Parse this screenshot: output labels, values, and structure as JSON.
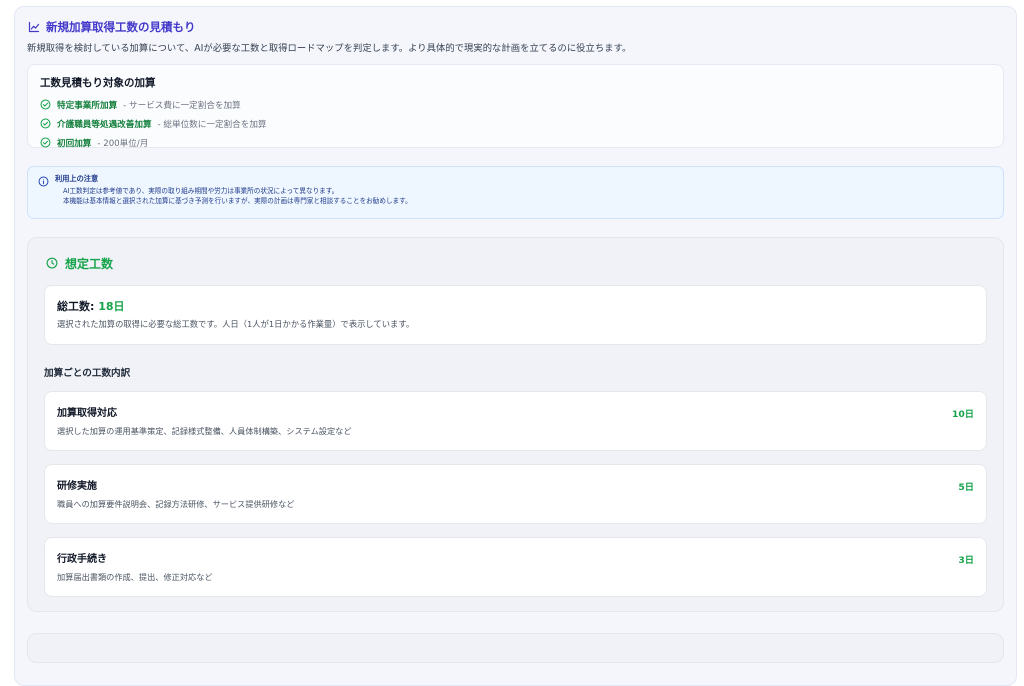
{
  "header": {
    "title": "新規加算取得工数の見積もり",
    "description": "新規取得を検討している加算について、AIが必要な工数と取得ロードマップを判定します。より具体的で現実的な計画を立てるのに役立ちます。"
  },
  "targets": {
    "title": "工数見積もり対象の加算",
    "items": [
      {
        "name": "特定事業所加算",
        "desc": " - サービス費に一定割合を加算"
      },
      {
        "name": "介護職員等処遇改善加算",
        "desc": " - 総単位数に一定割合を加算"
      },
      {
        "name": "初回加算",
        "desc": " - 200単位/月"
      }
    ]
  },
  "notice": {
    "title": "利用上の注意",
    "lines": [
      "AI工数判定は参考値であり、実際の取り組み期間や労力は事業所の状況によって異なります。",
      "本機能は基本情報と選択された加算に基づき予測を行いますが、実際の計画は専門家と相談することをお勧めします。"
    ]
  },
  "estimate": {
    "title": "想定工数",
    "total_label": "総工数: ",
    "total_value": "18日",
    "total_desc": "選択された加算の取得に必要な総工数です。人日（1人が1日かかる作業量）で表示しています。",
    "breakdown_title": "加算ごとの工数内訳",
    "breakdown": [
      {
        "name": "加算取得対応",
        "desc": "選択した加算の運用基準策定、記録様式整備、人員体制構築、システム設定など",
        "days": "10日"
      },
      {
        "name": "研修実施",
        "desc": "職員への加算要件説明会、記録方法研修、サービス提供研修など",
        "days": "5日"
      },
      {
        "name": "行政手続き",
        "desc": "加算届出書類の作成、提出、修正対応など",
        "days": "3日"
      }
    ]
  },
  "colors": {
    "accent": "#4338ca",
    "success": "#16a34a",
    "info": "#1e40af"
  }
}
